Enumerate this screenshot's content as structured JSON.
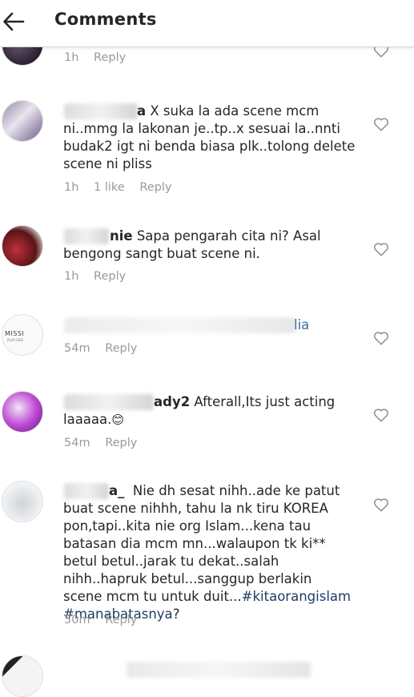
{
  "header": {
    "title": "Comments"
  },
  "comments": [
    {
      "username": "",
      "text": "",
      "time": "1h",
      "likes": "",
      "reply": "Reply"
    },
    {
      "username": "a",
      "text": " X suka la ada scene mcm ni..mmg la lakonan je..tp..x sesuai la..nnti budak2 igt ni benda biasa plk..tolong delete scene ni pliss",
      "time": "1h",
      "likes": "1 like",
      "reply": "Reply"
    },
    {
      "username": "nie",
      "text": " Sapa pengarah cita ni? Asal bengong sangt buat scene ni.",
      "time": "1h",
      "likes": "",
      "reply": "Reply"
    },
    {
      "username": "",
      "text": "lia",
      "time": "54m",
      "likes": "",
      "reply": "Reply",
      "avatar_text": [
        "MISSI",
        "PLUS SIZE"
      ]
    },
    {
      "username": "ady2",
      "text": " Afterall,Its just acting laaaaa.",
      "emoji": "😊",
      "time": "54m",
      "likes": "",
      "reply": "Reply"
    },
    {
      "username": "a_",
      "text": "  Nie dh sesat nihh..ade ke patut buat scene nihhh, tahu la nk tiru KOREA pon,tapi..kita nie org Islam...kena tau batasan dia mcm mn...walaupon tk ki** betul betul..jarak tu dekat..salah nihh..hapruk betul...sanggup berlakin scene mcm tu untuk duit...",
      "hashtags": [
        "#kitaorangislam",
        "#manabatasnya"
      ],
      "trail": "?",
      "time": "50m",
      "likes": "",
      "reply": "Reply"
    },
    {
      "username": "",
      "text": ""
    }
  ],
  "colors": {
    "hashtag": "#1f3d66",
    "meta": "#9a9a9a",
    "text": "#262626"
  }
}
